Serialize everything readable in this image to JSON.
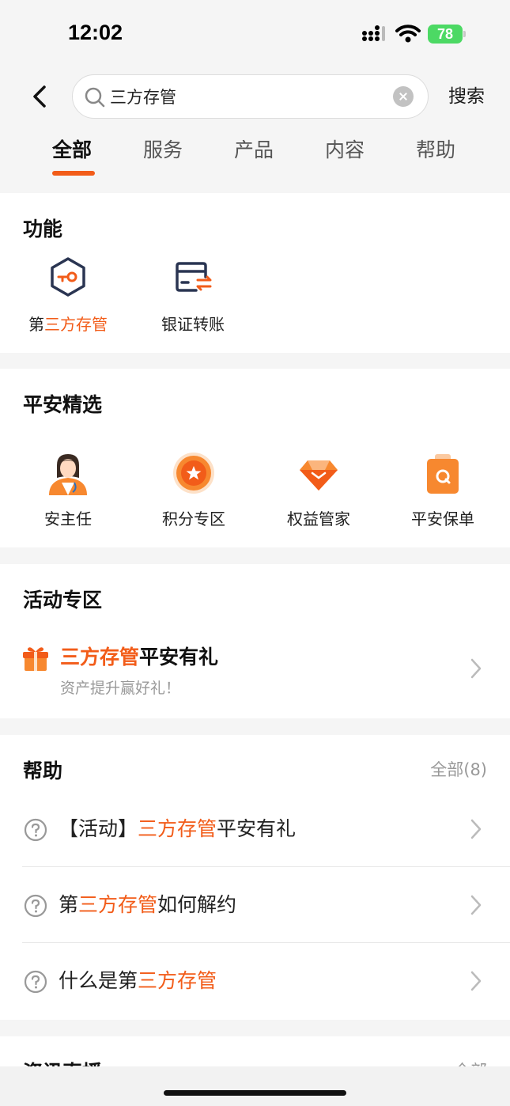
{
  "status": {
    "time": "12:02",
    "battery": "78"
  },
  "search": {
    "query": "三方存管",
    "button_label": "搜索"
  },
  "tabs": [
    {
      "label": "全部",
      "active": true
    },
    {
      "label": "服务",
      "active": false
    },
    {
      "label": "产品",
      "active": false
    },
    {
      "label": "内容",
      "active": false
    },
    {
      "label": "帮助",
      "active": false
    }
  ],
  "functions": {
    "title": "功能",
    "items": [
      {
        "prefix": "第",
        "highlight": "三方存管",
        "suffix": "",
        "icon": "hexagon-key-icon"
      },
      {
        "prefix": "银证转账",
        "highlight": "",
        "suffix": "",
        "icon": "card-transfer-icon"
      }
    ]
  },
  "selection": {
    "title": "平安精选",
    "items": [
      {
        "label": "安主任",
        "icon": "doctor-avatar-icon"
      },
      {
        "label": "积分专区",
        "icon": "points-star-icon"
      },
      {
        "label": "权益管家",
        "icon": "diamond-icon"
      },
      {
        "label": "平安保单",
        "icon": "policy-bag-icon"
      }
    ]
  },
  "activity": {
    "title": "活动专区",
    "item": {
      "highlight": "三方存管",
      "rest": "平安有礼",
      "subtitle": "资产提升赢好礼！",
      "icon": "gift-icon"
    }
  },
  "help": {
    "title": "帮助",
    "all_label": "全部(8)",
    "items": [
      {
        "prefix": "【活动】",
        "highlight": "三方存管",
        "suffix": "平安有礼"
      },
      {
        "prefix": "第",
        "highlight": "三方存管",
        "suffix": "如何解约"
      },
      {
        "prefix": "什么是第",
        "highlight": "三方存管",
        "suffix": ""
      }
    ]
  },
  "news": {
    "title": "资讯直播",
    "all_label": "全部"
  },
  "colors": {
    "accent": "#f25c19",
    "background": "#f5f5f5",
    "icon_navy": "#2a3552"
  }
}
